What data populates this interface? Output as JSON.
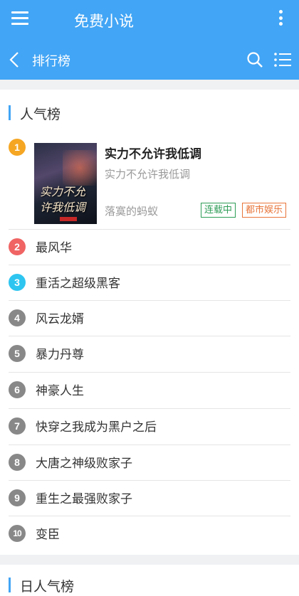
{
  "app": {
    "title": "免费小说"
  },
  "page": {
    "title": "排行榜"
  },
  "sections": [
    {
      "title": "人气榜",
      "top": {
        "rank": "1",
        "title": "实力不允许我低调",
        "description": "实力不允许我低调",
        "author": "落寞的蚂蚁",
        "status_tag": "连载中",
        "genre_tag": "都市娱乐",
        "cover_text": "实力不允许我低调"
      },
      "items": [
        {
          "rank": "2",
          "name": "最风华"
        },
        {
          "rank": "3",
          "name": "重活之超级黑客"
        },
        {
          "rank": "4",
          "name": "风云龙婿"
        },
        {
          "rank": "5",
          "name": "暴力丹尊"
        },
        {
          "rank": "6",
          "name": "神豪人生"
        },
        {
          "rank": "7",
          "name": "快穿之我成为黑户之后"
        },
        {
          "rank": "8",
          "name": "大唐之神级败家子"
        },
        {
          "rank": "9",
          "name": "重生之最强败家子"
        },
        {
          "rank": "10",
          "name": "变臣"
        }
      ]
    },
    {
      "title": "日人气榜"
    }
  ],
  "icons": {
    "menu": "hamburger-menu-icon",
    "more": "more-vertical-icon",
    "back": "back-arrow-icon",
    "search": "search-icon",
    "list": "list-icon"
  },
  "colors": {
    "primary": "#42a5f5",
    "rank1": "#f5a623",
    "rank2": "#f06464",
    "rank3": "#2ec5f0",
    "rank_other": "#888888",
    "status_tag": "#2e9d57",
    "genre_tag": "#e8753a"
  }
}
